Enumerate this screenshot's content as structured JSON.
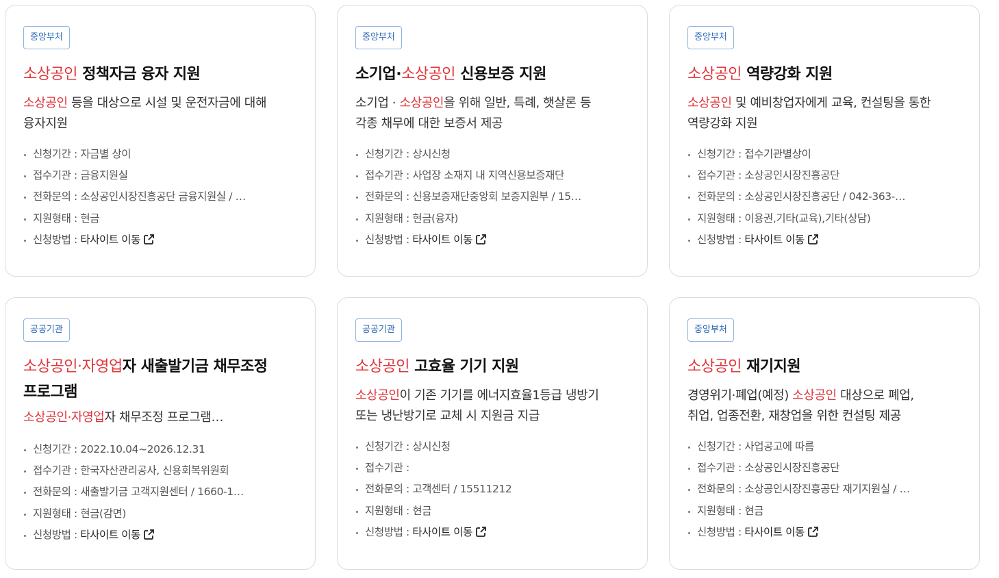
{
  "labels": {
    "period": "신청기간 : ",
    "agency": "접수기관 : ",
    "phone": "전화문의 : ",
    "type": "지원형태 : ",
    "method": "신청방법 : "
  },
  "cards": [
    {
      "badge": "중앙부처",
      "title_hl": "소상공인",
      "title_rest": " 정책자금 융자 지원",
      "desc_hl": "소상공인",
      "desc_rest": " 등을 대상으로 시설 및 운전자금에 대해",
      "desc_line2": "융자지원",
      "period": "자금별 상이",
      "agency": "금융지원실",
      "phone": "소상공인시장진흥공단 금융지원실 / …",
      "type": "현금",
      "method": "타사이트 이동"
    },
    {
      "badge": "중앙부처",
      "title_pre": "소기업·",
      "title_hl": "소상공인",
      "title_rest": " 신용보증 지원",
      "desc_pre": "소기업 · ",
      "desc_hl": "소상공인",
      "desc_rest": "을 위해 일반, 특례, 햇살론 등",
      "desc_line2": "각종 채무에 대한 보증서 제공",
      "period": "상시신청",
      "agency": "사업장 소재지 내 지역신용보증재단",
      "phone": "신용보증재단중앙회 보증지원부 / 15…",
      "type": "현금(융자)",
      "method": "타사이트 이동"
    },
    {
      "badge": "중앙부처",
      "title_hl": "소상공인",
      "title_rest": " 역량강화 지원",
      "desc_hl": "소상공인",
      "desc_rest": " 및 예비창업자에게 교육, 컨설팅을 통한",
      "desc_line2": "역량강화 지원",
      "period": "접수기관별상이",
      "agency": "소상공인시장진흥공단",
      "phone": "소상공인시장진흥공단 / 042-363-…",
      "type": "이용권,기타(교육),기타(상담)",
      "method": "타사이트 이동"
    },
    {
      "badge": "공공기관",
      "title_hl": "소상공인",
      "title_mid": "·",
      "title_hl2": "자영업",
      "title_rest": "자 새출발기금 채무조정",
      "title_line2": "프로그램",
      "desc_hl": "소상공인",
      "desc_mid": "·",
      "desc_hl2": "자영업",
      "desc_rest": "자 채무조정 프로그램…",
      "period": "2022.10.04~2026.12.31",
      "agency": "한국자산관리공사, 신용회복위원회",
      "phone": "새출발기금 고객지원센터 / 1660-1…",
      "type": "현금(감면)",
      "method": "타사이트 이동"
    },
    {
      "badge": "공공기관",
      "title_hl": "소상공인",
      "title_rest": " 고효율 기기 지원",
      "desc_hl": "소상공인",
      "desc_rest": "이 기존 기기를 에너지효율1등급 냉방기",
      "desc_line2": "또는 냉난방기로 교체 시 지원금 지급",
      "period": "상시신청",
      "agency": "",
      "phone": "고객센터 / 15511212",
      "type": "현금",
      "method": "타사이트 이동"
    },
    {
      "badge": "중앙부처",
      "title_hl": "소상공인",
      "title_rest": " 재기지원",
      "desc_pre": "경영위기·폐업(예정) ",
      "desc_hl": "소상공인",
      "desc_rest": " 대상으로 폐업,",
      "desc_line2": "취업, 업종전환, 재창업을 위한 컨설팅 제공",
      "period": "사업공고에 따름",
      "agency": "소상공인시장진흥공단",
      "phone": "소상공인시장진흥공단 재기지원실 / …",
      "type": "현금",
      "method": "타사이트 이동"
    }
  ]
}
